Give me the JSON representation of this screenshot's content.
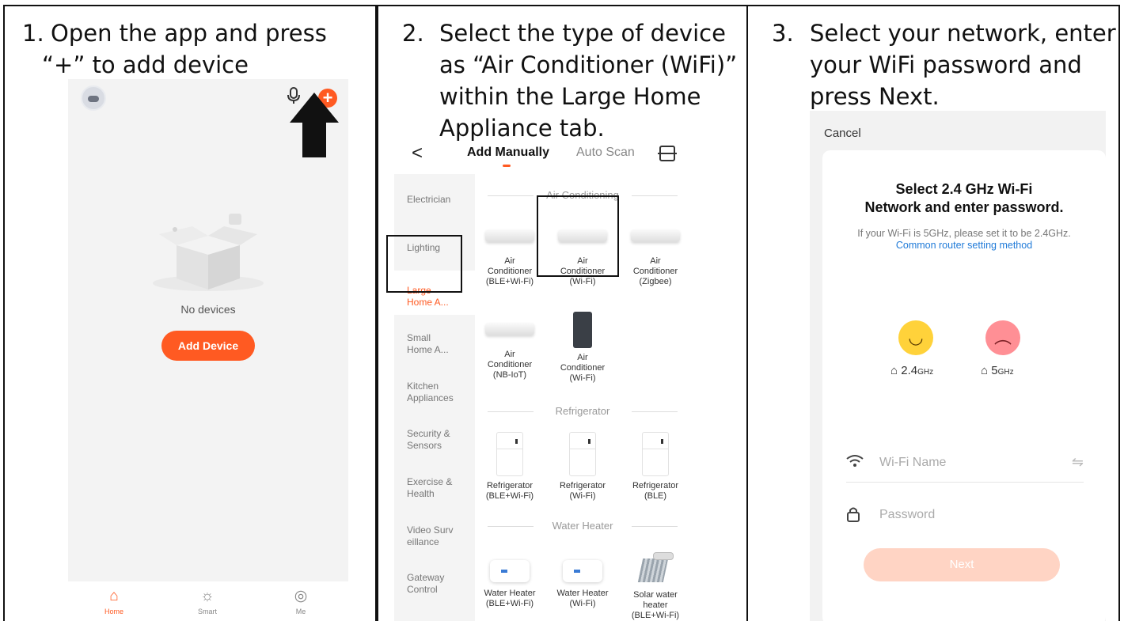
{
  "steps": [
    {
      "num": "1.",
      "lines": [
        "Open the app and press",
        "“+” to add device"
      ]
    },
    {
      "num": "2.",
      "lines": [
        "Select the type of device",
        "as “Air Conditioner (WiFi)”",
        "within the Large Home",
        "Appliance tab."
      ]
    },
    {
      "num": "3.",
      "lines": [
        "Select your network, enter",
        "your WiFi password and",
        "press Next."
      ]
    }
  ],
  "home_screen": {
    "mic_icon": "microphone-icon",
    "plus_label": "+",
    "empty_text": "No devices",
    "add_button": "Add Device",
    "tabs": [
      {
        "label": "Home",
        "icon": "home-icon",
        "glyph": "⌂"
      },
      {
        "label": "Smart",
        "icon": "sun-icon",
        "glyph": "☼"
      },
      {
        "label": "Me",
        "icon": "user-icon",
        "glyph": "◎"
      }
    ],
    "accent": "#ff5a22"
  },
  "add_device_screen": {
    "back": "<",
    "tab_manual": "Add Manually",
    "tab_auto": "Auto Scan",
    "categories": [
      {
        "label": [
          "Electrician"
        ]
      },
      {
        "label": [
          "Lighting"
        ]
      },
      {
        "label": [
          "Large",
          "Home A..."
        ],
        "active": true
      },
      {
        "label": [
          "Small",
          "Home A..."
        ]
      },
      {
        "label": [
          "Kitchen",
          "Appliances"
        ]
      },
      {
        "label": [
          "Security &",
          "Sensors"
        ]
      },
      {
        "label": [
          "Exercise &",
          "Health"
        ]
      },
      {
        "label": [
          "Video Surv",
          "eillance"
        ]
      },
      {
        "label": [
          "Gateway",
          "Control"
        ]
      }
    ],
    "sections": [
      {
        "title": "Air Conditioning"
      },
      {
        "title": "Refrigerator"
      },
      {
        "title": "Water Heater"
      }
    ],
    "devices": [
      {
        "lines": [
          "Air",
          "Conditioner",
          "(BLE+Wi-Fi)"
        ]
      },
      {
        "lines": [
          "Air",
          "Conditioner",
          "(Wi-Fi)"
        ]
      },
      {
        "lines": [
          "Air",
          "Conditioner",
          "(Zigbee)"
        ]
      },
      {
        "lines": [
          "Air",
          "Conditioner",
          "(NB-IoT)"
        ]
      },
      {
        "lines": [
          "Air",
          "Conditioner",
          "(Wi-Fi)"
        ]
      },
      {
        "lines": [
          "Refrigerator",
          "(BLE+Wi-Fi)"
        ]
      },
      {
        "lines": [
          "Refrigerator",
          "(Wi-Fi)"
        ]
      },
      {
        "lines": [
          "Refrigerator",
          "(BLE)"
        ]
      },
      {
        "lines": [
          "Water Heater",
          "(BLE+Wi-Fi)"
        ]
      },
      {
        "lines": [
          "Water Heater",
          "(Wi-Fi)"
        ]
      },
      {
        "lines": [
          "Solar water",
          "heater",
          "(BLE+Wi-Fi)"
        ]
      }
    ]
  },
  "wifi_screen": {
    "cancel": "Cancel",
    "heading_lines": [
      "Select 2.4 GHz Wi-Fi",
      "Network and enter password."
    ],
    "sub_text": "If your Wi-Fi is 5GHz, please set it to be 2.4GHz.",
    "sub_link": "Common router setting method",
    "band_24": "2.4",
    "band_5": "5",
    "ghz": "GHz",
    "wifi_name_placeholder": "Wi-Fi Name",
    "password_placeholder": "Password",
    "next_button": "Next"
  }
}
